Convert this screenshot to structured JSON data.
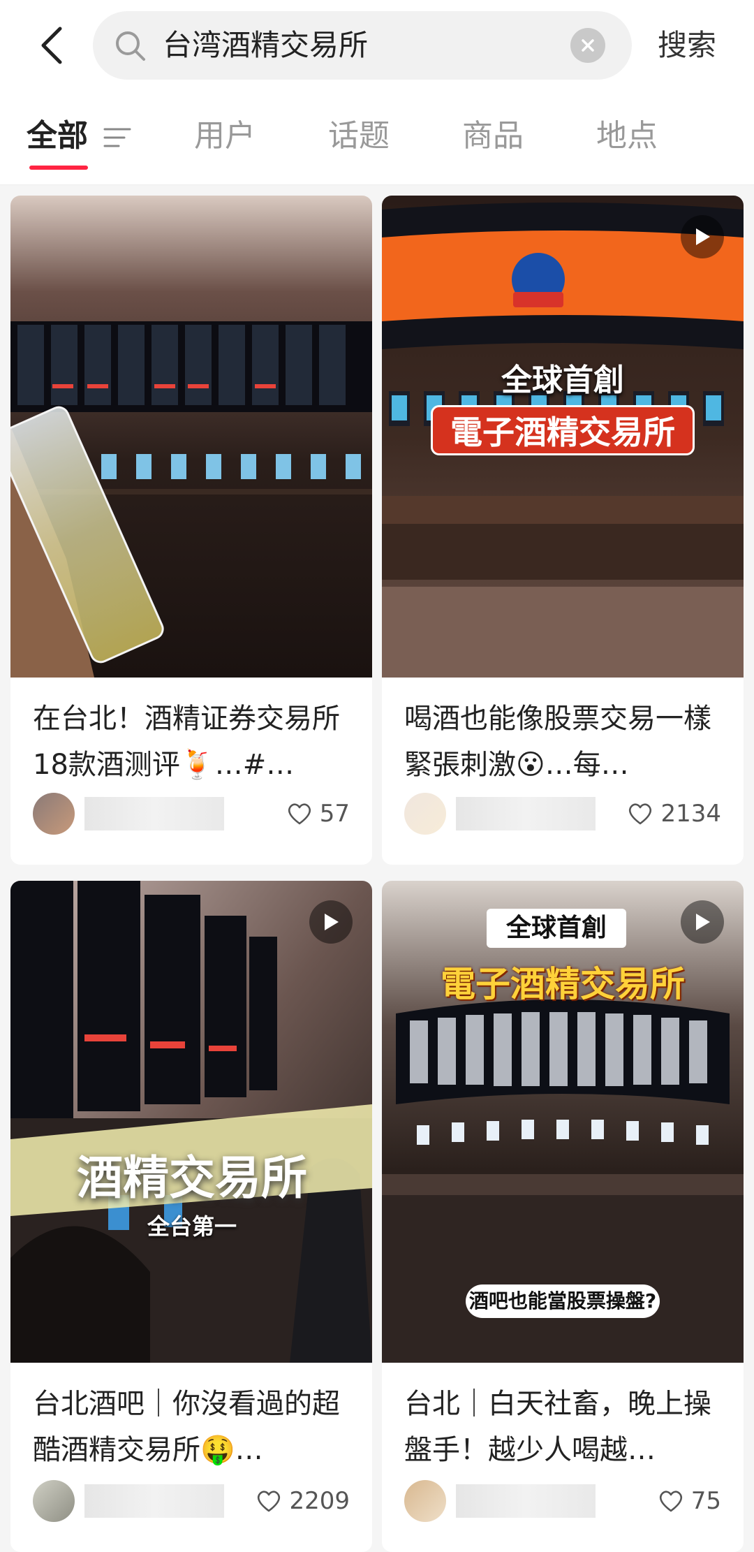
{
  "search": {
    "query": "台湾酒精交易所",
    "action_label": "搜索"
  },
  "tabs": [
    {
      "label": "全部"
    },
    {
      "label": "用户"
    },
    {
      "label": "话题"
    },
    {
      "label": "商品"
    },
    {
      "label": "地点"
    }
  ],
  "cards": [
    {
      "title": "在台北！酒精证券交易所18款酒测评🍹…#…",
      "likes": "57",
      "overlay_lines": []
    },
    {
      "title": "喝酒也能像股票交易一樣緊張刺激😮…每…",
      "likes": "2134",
      "overlay_lines": [
        "全球首創",
        "電子酒精交易所"
      ]
    },
    {
      "title": "台北酒吧｜你沒看過的超酷酒精交易所🤑…",
      "likes": "2209",
      "overlay_lines": [
        "酒精交易所",
        "全台第一"
      ]
    },
    {
      "title": "台北｜白天社畜，晚上操盤手！越少人喝越…",
      "likes": "75",
      "overlay_lines": [
        "全球首創",
        "電子酒精交易所",
        "酒吧也能當股票操盤?"
      ]
    }
  ],
  "colors": {
    "accent": "#ff2442"
  }
}
